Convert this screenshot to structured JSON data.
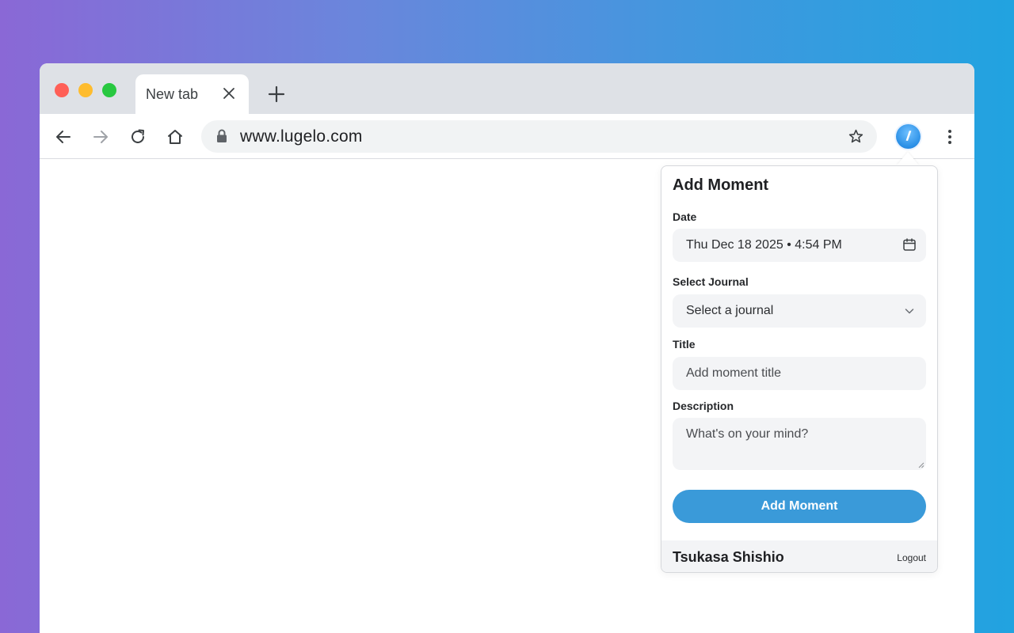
{
  "browser": {
    "tab_title": "New tab",
    "url": "www.lugelo.com",
    "extension_glyph": "l"
  },
  "popup": {
    "title": "Add Moment",
    "date": {
      "label": "Date",
      "value": "Thu Dec 18 2025 • 4:54 PM"
    },
    "journal": {
      "label": "Select Journal",
      "value": "Select a journal"
    },
    "title_field": {
      "label": "Title",
      "placeholder": "Add moment title"
    },
    "description": {
      "label": "Description",
      "placeholder": "What's on your mind?"
    },
    "submit_label": "Add Moment",
    "footer": {
      "user_name": "Tsukasa Shishio",
      "logout_label": "Logout"
    }
  },
  "colors": {
    "accent": "#3a9ad9",
    "field_bg": "#f3f4f6",
    "tabstrip": "#dee1e6"
  },
  "icons": [
    "close-icon",
    "plus-icon",
    "back-icon",
    "forward-icon",
    "reload-icon",
    "home-icon",
    "lock-icon",
    "star-icon",
    "kebab-menu-icon",
    "calendar-icon",
    "chevron-down-icon"
  ]
}
